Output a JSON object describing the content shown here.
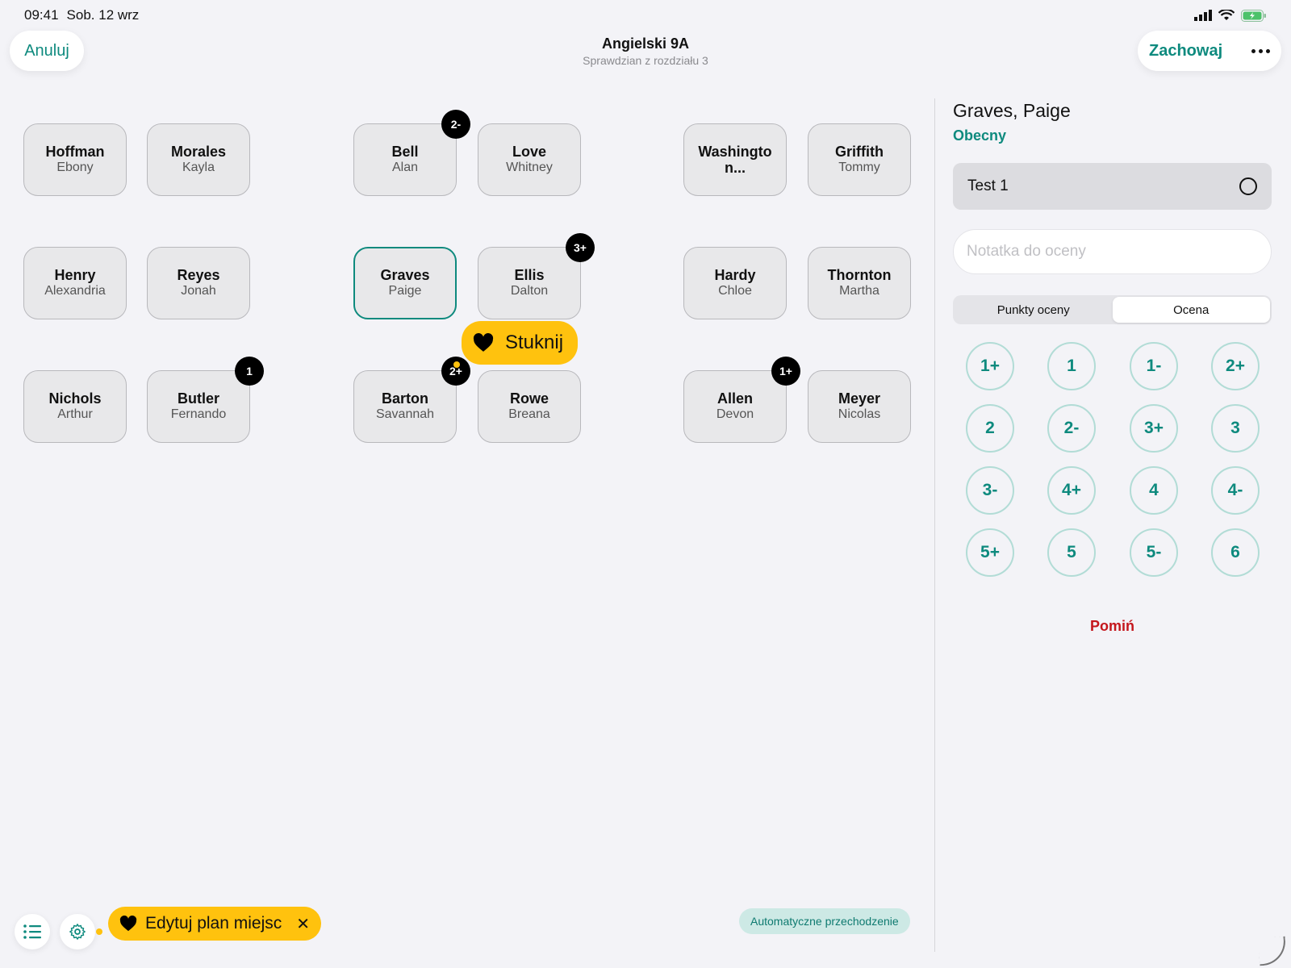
{
  "status_bar": {
    "time": "09:41",
    "date": "Sob. 12 wrz"
  },
  "header": {
    "cancel_label": "Anuluj",
    "save_label": "Zachowaj",
    "title": "Angielski 9A",
    "subtitle": "Sprawdzian z rozdziału 3"
  },
  "seats": [
    {
      "last": "Hoffman",
      "first": "Ebony",
      "badge": ""
    },
    {
      "last": "Morales",
      "first": "Kayla",
      "badge": ""
    },
    {
      "last": "Bell",
      "first": "Alan",
      "badge": "2-"
    },
    {
      "last": "Love",
      "first": "Whitney",
      "badge": ""
    },
    {
      "last": "Washingto n...",
      "first": "",
      "badge": ""
    },
    {
      "last": "Griffith",
      "first": "Tommy",
      "badge": ""
    },
    {
      "last": "Henry",
      "first": "Alexandria",
      "badge": ""
    },
    {
      "last": "Reyes",
      "first": "Jonah",
      "badge": ""
    },
    {
      "last": "Graves",
      "first": "Paige",
      "badge": ""
    },
    {
      "last": "Ellis",
      "first": "Dalton",
      "badge": "3+"
    },
    {
      "last": "Hardy",
      "first": "Chloe",
      "badge": ""
    },
    {
      "last": "Thornton",
      "first": "Martha",
      "badge": ""
    },
    {
      "last": "Nichols",
      "first": "Arthur",
      "badge": ""
    },
    {
      "last": "Butler",
      "first": "Fernando",
      "badge": "1"
    },
    {
      "last": "Barton",
      "first": "Savannah",
      "badge": "2+"
    },
    {
      "last": "Rowe",
      "first": "Breana",
      "badge": ""
    },
    {
      "last": "Allen",
      "first": "Devon",
      "badge": "1+"
    },
    {
      "last": "Meyer",
      "first": "Nicolas",
      "badge": ""
    }
  ],
  "tooltips": {
    "tap": "Stuknij",
    "edit_seating": "Edytuj plan miejsc"
  },
  "auto_advance_label": "Automatyczne przechodzenie",
  "panel": {
    "student_name": "Graves, Paige",
    "attendance": "Obecny",
    "test_name": "Test 1",
    "note_placeholder": "Notatka do oceny",
    "tab_points": "Punkty oceny",
    "tab_grade": "Ocena",
    "grades": [
      "1+",
      "1",
      "1-",
      "2+",
      "2",
      "2-",
      "3+",
      "3",
      "3-",
      "4+",
      "4",
      "4-",
      "5+",
      "5",
      "5-",
      "6"
    ],
    "skip_label": "Pomiń"
  },
  "colors": {
    "accent": "#0e8a7e",
    "tooltip": "#ffc20e",
    "danger": "#c4161c"
  }
}
